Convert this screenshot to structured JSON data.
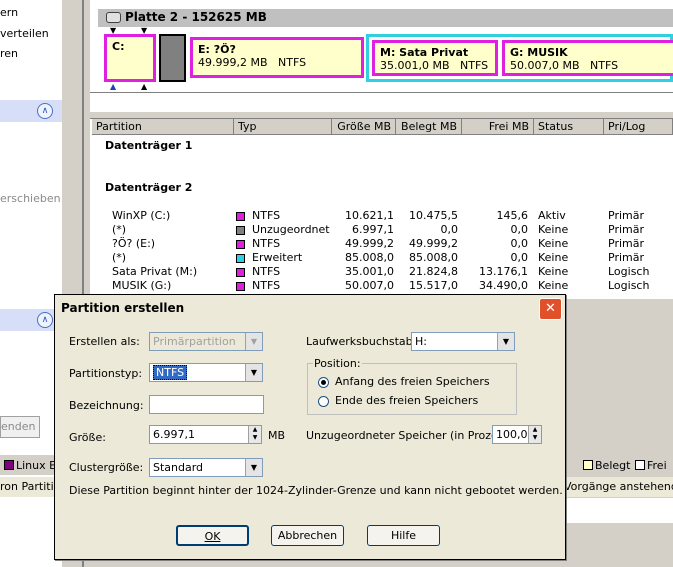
{
  "sidebar": {
    "items": [
      "ern",
      "verteilen",
      "ren"
    ],
    "lower_item": "erschieben",
    "bottom_button": "enden"
  },
  "disk": {
    "title": "Platte 2 - 152625 MB",
    "partitions": [
      {
        "label": "C:",
        "size": "",
        "fs": ""
      },
      {
        "label": "E:  ?Ö?",
        "size": "49.999,2 MB",
        "fs": "NTFS"
      },
      {
        "label": "M:  Sata Privat",
        "size": "35.001,0 MB",
        "fs": "NTFS"
      },
      {
        "label": "G:  MUSIK",
        "size": "50.007,0 MB",
        "fs": "NTFS"
      }
    ]
  },
  "list": {
    "headers": [
      "Partition",
      "Typ",
      "Größe MB",
      "Belegt MB",
      "Frei MB",
      "Status",
      "Pri/Log"
    ],
    "group1": "Datenträger 1",
    "group2": "Datenträger 2",
    "rows": [
      {
        "name": "WinXP (C:)",
        "type": "NTFS",
        "color": "#e020e0",
        "size": "10.621,1",
        "used": "10.475,5",
        "free": "145,6",
        "status": "Aktiv",
        "pl": "Primär"
      },
      {
        "name": "(*)",
        "type": "Unzugeordnet",
        "color": "#808080",
        "size": "6.997,1",
        "used": "0,0",
        "free": "0,0",
        "status": "Keine",
        "pl": "Primär"
      },
      {
        "name": "?Ö? (E:)",
        "type": "NTFS",
        "color": "#e020e0",
        "size": "49.999,2",
        "used": "49.999,2",
        "free": "0,0",
        "status": "Keine",
        "pl": "Primär"
      },
      {
        "name": "(*)",
        "type": "Erweitert",
        "color": "#30d0e0",
        "size": "85.008,0",
        "used": "85.008,0",
        "free": "0,0",
        "status": "Keine",
        "pl": "Primär"
      },
      {
        "name": "Sata Privat  (M:)",
        "type": "NTFS",
        "color": "#e020e0",
        "size": "35.001,0",
        "used": "21.824,8",
        "free": "13.176,1",
        "status": "Keine",
        "pl": "Logisch"
      },
      {
        "name": "MUSIK (G:)",
        "type": "NTFS",
        "color": "#e020e0",
        "size": "50.007,0",
        "used": "15.517,0",
        "free": "34.490,0",
        "status": "Keine",
        "pl": "Logisch"
      }
    ]
  },
  "legend": {
    "linux": "Linux E:",
    "used": "Belegt",
    "free": "Frei"
  },
  "statusbar": {
    "left": "ron Partition",
    "right": "Vorgänge anstehend"
  },
  "dialog": {
    "title": "Partition erstellen",
    "create_as_label": "Erstellen als:",
    "create_as_value": "Primärpartition",
    "part_type_label": "Partitionstyp:",
    "part_type_value": "NTFS",
    "name_label": "Bezeichnung:",
    "name_value": "",
    "size_label": "Größe:",
    "size_value": "6.997,1",
    "size_unit": "MB",
    "cluster_label": "Clustergröße:",
    "cluster_value": "Standard",
    "drive_letter_label": "Laufwerksbuchstabe:",
    "drive_letter_value": "H:",
    "position_label": "Position:",
    "pos_start": "Anfang des freien Speichers",
    "pos_end": "Ende des freien Speichers",
    "unalloc_label": "Unzugeordneter Speicher (in Prozent):",
    "unalloc_value": "100,0",
    "info_text": "Diese Partition beginnt hinter der 1024-Zylinder-Grenze und kann nicht gebootet werden.",
    "ok": "OK",
    "cancel": "Abbrechen",
    "help": "Hilfe"
  }
}
